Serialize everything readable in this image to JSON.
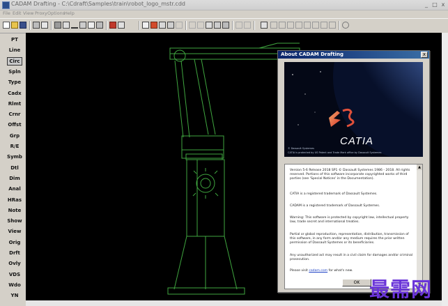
{
  "window": {
    "title": "CADAM Drafting - C:\\Cdraft\\Samples\\train\\robot_logo_mstr.cdd",
    "controls": [
      "_",
      "□",
      "x"
    ]
  },
  "menu": [
    "File",
    "Edit",
    "View",
    "Proxy",
    "Options",
    "Help"
  ],
  "palette": {
    "active": "Circ",
    "items": [
      "PT",
      "Line",
      "Circ",
      "Spln",
      "Type",
      "Cadx",
      "Rlmt",
      "Crnr",
      "Offst",
      "Grp",
      "R/E",
      "Symb",
      "Dtl",
      "Dim",
      "Anal",
      "HRas",
      "Note",
      "Show",
      "View",
      "Orig",
      "Drft",
      "Ovly",
      "VDS",
      "Wdo",
      "YN"
    ]
  },
  "dialog": {
    "title": "About CADAM Drafting",
    "close": "x",
    "logo_text": "CATIA",
    "banner_notes": [
      "© Dassault Systemes",
      "CATIA is protected by US Patent and Trade Mark office by Dassault Systemes"
    ],
    "paragraphs": [
      "Version 5-6 Release 2018 SP1 © Dassault Systemes 1986 - 2018. All rights reserved. Portions of this software incorporate copyrighted works of third parties (see 'Special Notices' in the Documentation).",
      "CATIA is a registered trademark of Dassault Systemes.",
      "CADAM is a registered trademark of Dassault Systemes.",
      "Warning: This software is protected by copyright law, intellectual property law, trade secret and international treaties.",
      "Partial or global reproduction, representation, distribution, transmission of this software, in any form and/or any medium requires the prior written permission of Dassault Systemes or its beneficiaries.",
      "Any unauthorized act may result in a civil claim for damages and/or criminal prosecution."
    ],
    "visit_prefix": "Please visit",
    "visit_link": "cadam.com",
    "visit_suffix": "for what's new.",
    "ok_label": "OK"
  },
  "watermark": "最需网",
  "colors": {
    "canvas": "#000000",
    "drawing_lines": "#3fa63f",
    "dialog_title": "#0a246a",
    "watermark": "#6a35d8"
  }
}
